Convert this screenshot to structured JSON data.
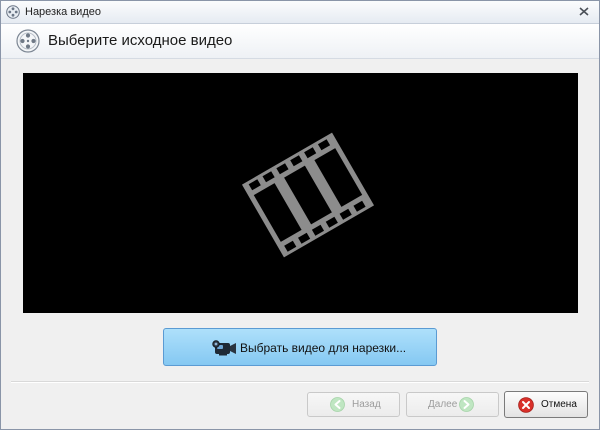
{
  "window": {
    "title": "Нарезка видео",
    "app_icon": "film-reel-icon",
    "close_icon": "close-icon"
  },
  "header": {
    "title": "Выберите исходное видео",
    "icon": "film-reel-icon"
  },
  "preview": {
    "background": "#000000",
    "placeholder_icon": "film-strip-icon",
    "placeholder_color": "#8c8c8c"
  },
  "select_video": {
    "label": "Выбрать видео для нарезки...",
    "icon": "camcorder-icon",
    "background": "#9fd6f7",
    "border": "#5b9bd3"
  },
  "footer": {
    "back": {
      "label": "Назад",
      "icon": "arrow-left-circle-icon",
      "enabled": false
    },
    "next": {
      "label": "Далее",
      "icon": "arrow-right-circle-icon",
      "enabled": false
    },
    "cancel": {
      "label": "Отмена",
      "icon": "cancel-circle-icon",
      "accent": "#d9302a"
    }
  }
}
